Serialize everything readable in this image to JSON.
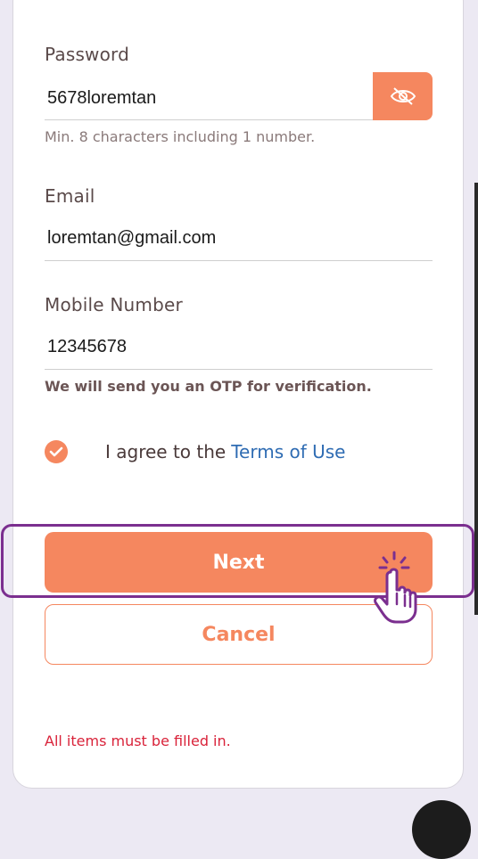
{
  "form": {
    "password": {
      "label": "Password",
      "value": "5678loremtan",
      "helper": "Min. 8 characters including 1 number."
    },
    "email": {
      "label": "Email",
      "value": "loremtan@gmail.com"
    },
    "mobile": {
      "label": "Mobile Number",
      "value": "12345678",
      "helper": "We will send you an OTP for verification."
    },
    "agree": {
      "text": "I agree to the",
      "link": "Terms of Use",
      "checked": true
    },
    "buttons": {
      "next": "Next",
      "cancel": "Cancel"
    },
    "error": "All items must be filled in."
  },
  "icons": {
    "eye": "eye-off-icon",
    "check": "check-icon",
    "cursor": "hand-pointer-icon"
  },
  "colors": {
    "accent": "#f5875f",
    "highlight": "#7b2f8f",
    "link": "#2f6cb3",
    "error": "#d9233a"
  }
}
